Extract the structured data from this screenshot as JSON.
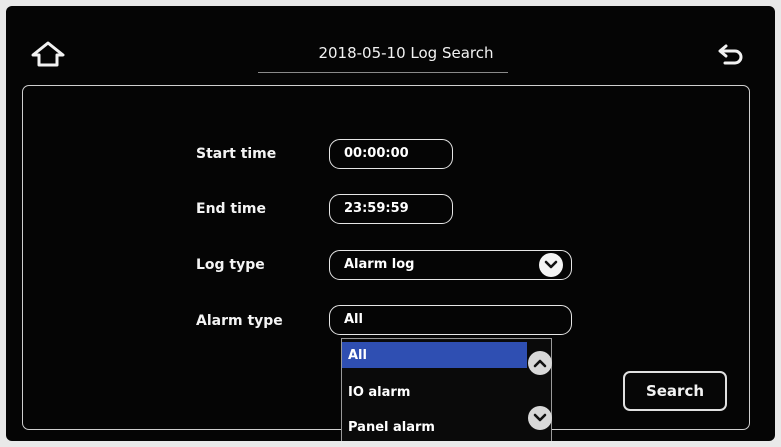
{
  "header": {
    "title": "2018-05-10  Log Search",
    "home_icon": "home-icon",
    "back_icon": "back-arrow-icon"
  },
  "form": {
    "start_time": {
      "label": "Start time",
      "value": "00:00:00"
    },
    "end_time": {
      "label": "End time",
      "value": "23:59:59"
    },
    "log_type": {
      "label": "Log type",
      "value": "Alarm log"
    },
    "alarm_type": {
      "label": "Alarm type",
      "value": "All"
    }
  },
  "alarm_type_dropdown": {
    "options": [
      "All",
      "IO alarm",
      "Panel alarm"
    ],
    "selected": "All"
  },
  "search_button": {
    "label": "Search"
  },
  "colors": {
    "background": "#050505",
    "selection": "#2f4fb2",
    "text": "#ffffff"
  }
}
